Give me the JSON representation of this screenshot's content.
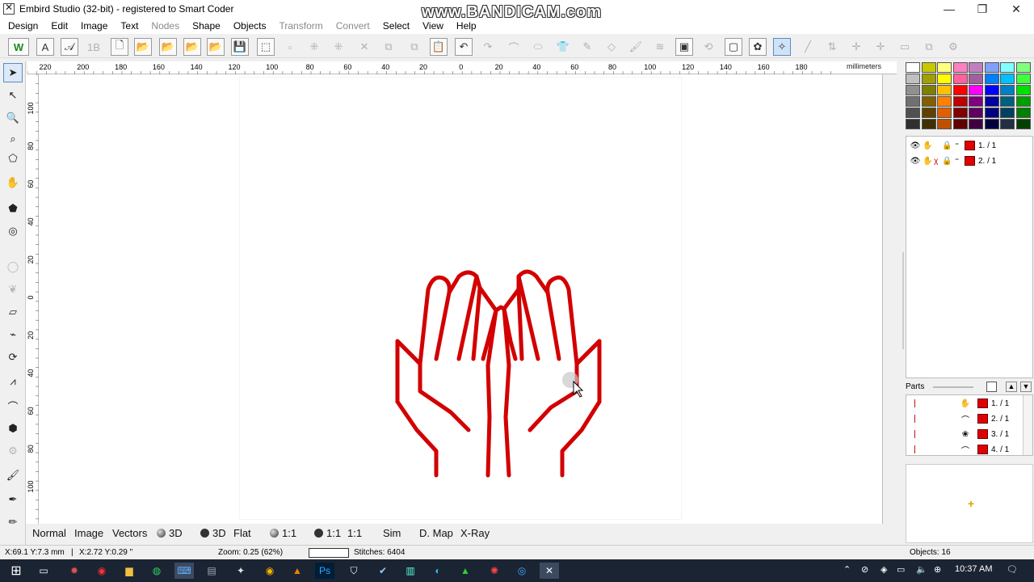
{
  "window": {
    "title": "Embird Studio (32-bit)  - registered to Smart Coder",
    "watermark": "www.BANDICAM.com",
    "controls": [
      "—",
      "❐",
      "✕"
    ]
  },
  "menu": [
    {
      "label": "Design",
      "enabled": true
    },
    {
      "label": "Edit",
      "enabled": true
    },
    {
      "label": "Image",
      "enabled": true
    },
    {
      "label": "Text",
      "enabled": true
    },
    {
      "label": "Nodes",
      "enabled": false
    },
    {
      "label": "Shape",
      "enabled": true
    },
    {
      "label": "Objects",
      "enabled": true
    },
    {
      "label": "Transform",
      "enabled": false
    },
    {
      "label": "Convert",
      "enabled": false
    },
    {
      "label": "Select",
      "enabled": true
    },
    {
      "label": "View",
      "enabled": true
    },
    {
      "label": "Help",
      "enabled": true
    }
  ],
  "ruler": {
    "unit": "millimeters",
    "top_ticks": [
      "220",
      "200",
      "180",
      "160",
      "140",
      "120",
      "100",
      "80",
      "60",
      "40",
      "20",
      "0",
      "20",
      "40",
      "60",
      "80",
      "100",
      "120",
      "140",
      "160",
      "180"
    ],
    "left_ticks": [
      "100",
      "80",
      "60",
      "40",
      "20",
      "0",
      "20",
      "40",
      "60",
      "80",
      "100"
    ]
  },
  "view_modes": [
    {
      "label": "Normal",
      "icon": ""
    },
    {
      "label": "Image",
      "icon": ""
    },
    {
      "label": "Vectors",
      "icon": ""
    },
    {
      "label": "3D",
      "icon": "sphere-icon"
    },
    {
      "label": "3D",
      "icon": "ball-icon"
    },
    {
      "label": "Flat",
      "icon": ""
    },
    {
      "label": "1:1",
      "icon": "sphere-icon"
    },
    {
      "label": "1:1",
      "icon": "ball-icon"
    },
    {
      "label": "1:1",
      "icon": ""
    },
    {
      "label": "Sim",
      "icon": ""
    },
    {
      "label": "D. Map",
      "icon": ""
    },
    {
      "label": "X-Ray",
      "icon": ""
    }
  ],
  "objects_panel": {
    "rows": [
      {
        "label": "1.  / 1",
        "color": "#e00000"
      },
      {
        "label": "2.  / 1",
        "color": "#e00000"
      }
    ]
  },
  "parts_panel": {
    "header": "Parts",
    "rows": [
      {
        "label": "1.  / 1"
      },
      {
        "label": "2.  / 1"
      },
      {
        "label": "3.  / 1"
      },
      {
        "label": "4.  / 1"
      }
    ]
  },
  "palette": {
    "colors": [
      [
        "#ffffff",
        "#c8c800",
        "#ffff80",
        "#ff80c0",
        "#c080c0",
        "#80a0ff",
        "#80ffff",
        "#80ff80"
      ],
      [
        "#c0c0c0",
        "#a0a000",
        "#ffff00",
        "#ff60a0",
        "#a060a0",
        "#0080ff",
        "#00c0ff",
        "#40ff40"
      ],
      [
        "#909090",
        "#808000",
        "#ffc000",
        "#ff0000",
        "#ff00ff",
        "#0000ff",
        "#0080c0",
        "#00e000"
      ],
      [
        "#707070",
        "#806000",
        "#ff8000",
        "#c00000",
        "#800080",
        "#0000a0",
        "#006080",
        "#00a000"
      ],
      [
        "#505050",
        "#604000",
        "#e06000",
        "#800000",
        "#600060",
        "#000080",
        "#004060",
        "#008000"
      ],
      [
        "#303030",
        "#403000",
        "#c05000",
        "#600000",
        "#400040",
        "#000040",
        "#203040",
        "#004000"
      ]
    ],
    "selected": "#ff0000"
  },
  "status": {
    "cursor": "X:69.1  Y:7.3 mm",
    "offset": "X:2.72  Y:0.29 \"",
    "zoom": "Zoom: 0.25 (62%)",
    "stitches": "Stitches: 6404",
    "objects": "Objects: 16"
  },
  "taskbar": {
    "time": "10:37 AM"
  },
  "design": {
    "stroke_color": "#d20000"
  }
}
